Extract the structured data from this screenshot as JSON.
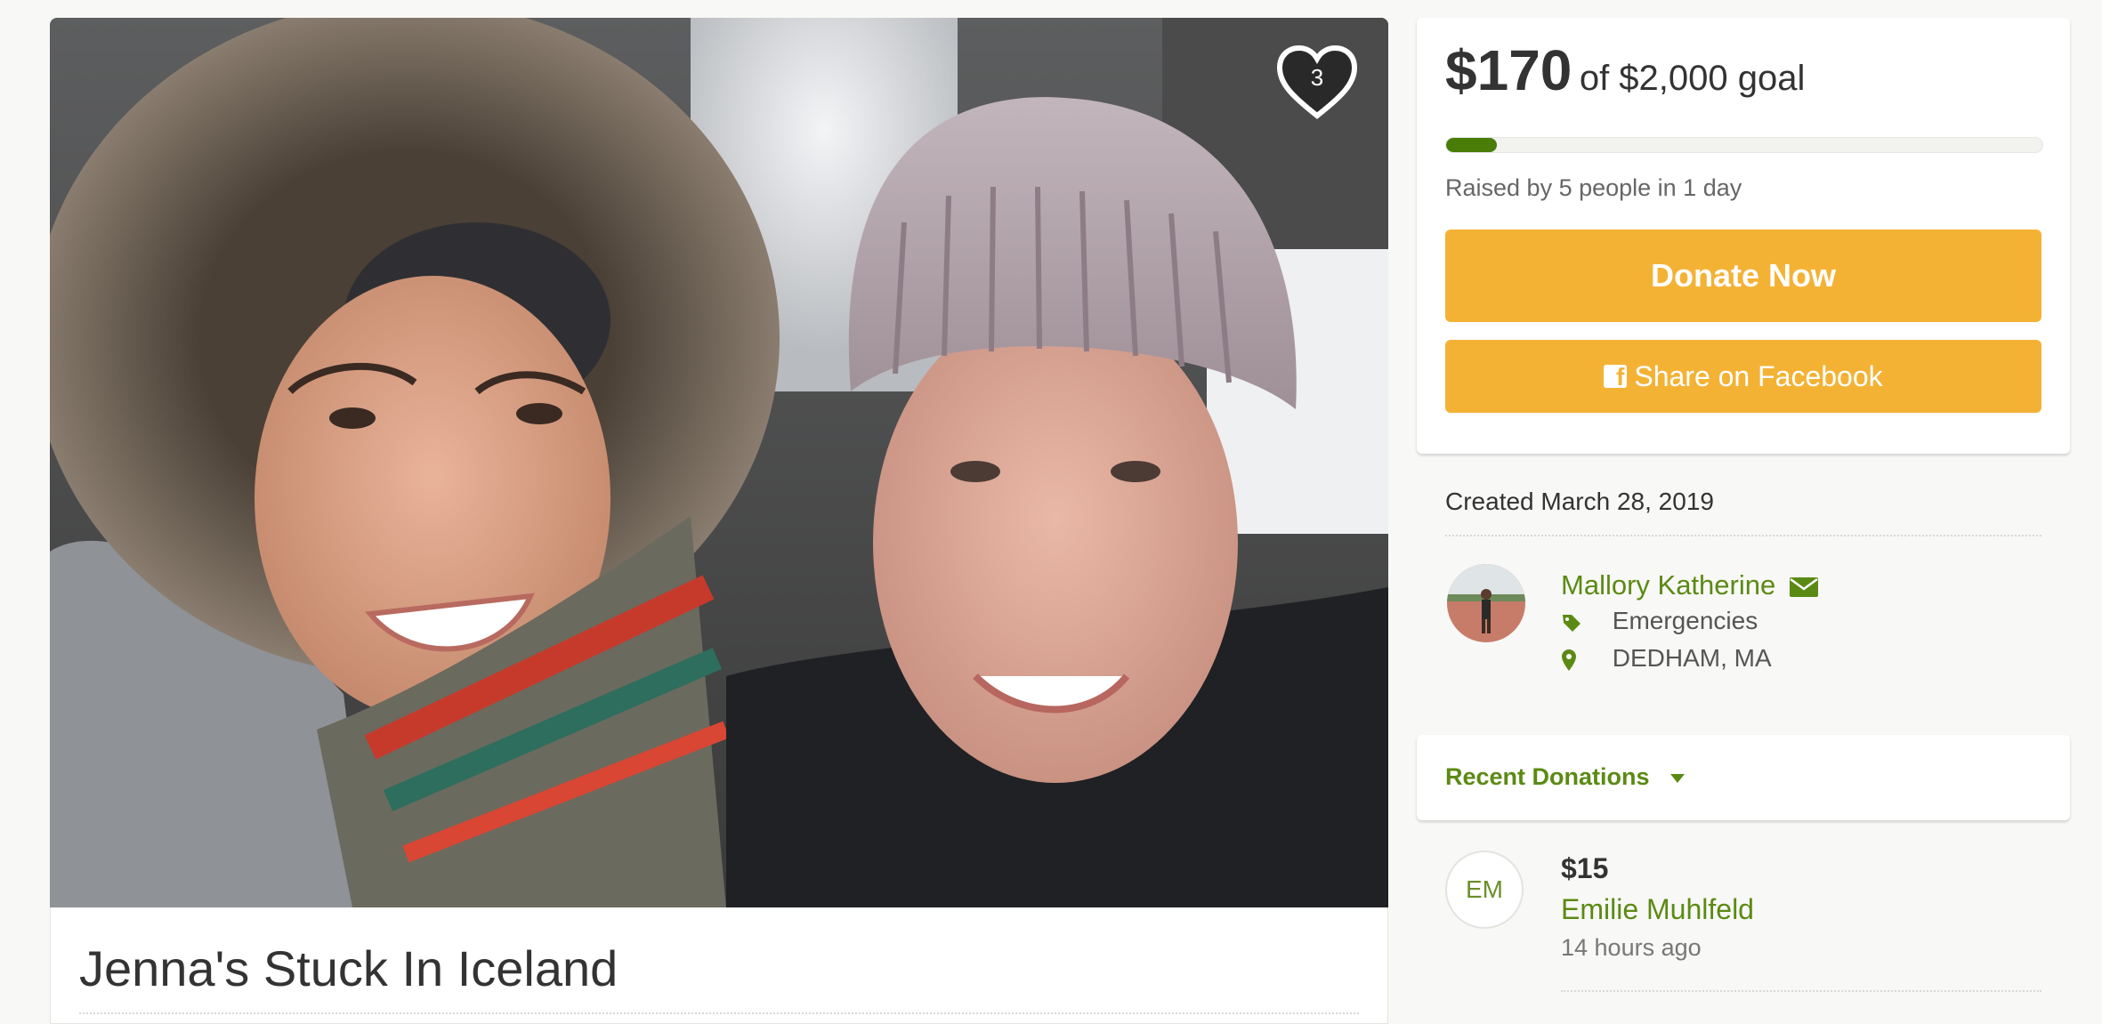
{
  "campaign": {
    "title": "Jenna's Stuck In Iceland",
    "heart_count": "3"
  },
  "progress": {
    "raised": "$170",
    "goal_text": "of $2,000 goal",
    "fraction": 0.085,
    "raised_by": "Raised by 5 people in 1 day",
    "fill_color": "#497d07"
  },
  "actions": {
    "donate_label": "Donate Now",
    "share_label": "Share on Facebook",
    "button_color": "#f4b235"
  },
  "organizer": {
    "created": "Created March 28, 2019",
    "name": "Mallory Katherine",
    "category": "Emergencies",
    "location": "DEDHAM, MA"
  },
  "recent_donations": {
    "label": "Recent Donations",
    "items": [
      {
        "initials": "EM",
        "amount": "$15",
        "name": "Emilie Muhlfeld",
        "time": "14 hours ago"
      }
    ]
  },
  "icons": [
    "heart-icon",
    "facebook-icon",
    "mail-icon",
    "tag-icon",
    "map-pin-icon",
    "caret-down-icon"
  ],
  "colors": {
    "accent_green": "#5b8a14",
    "button_yellow": "#f4b235"
  }
}
